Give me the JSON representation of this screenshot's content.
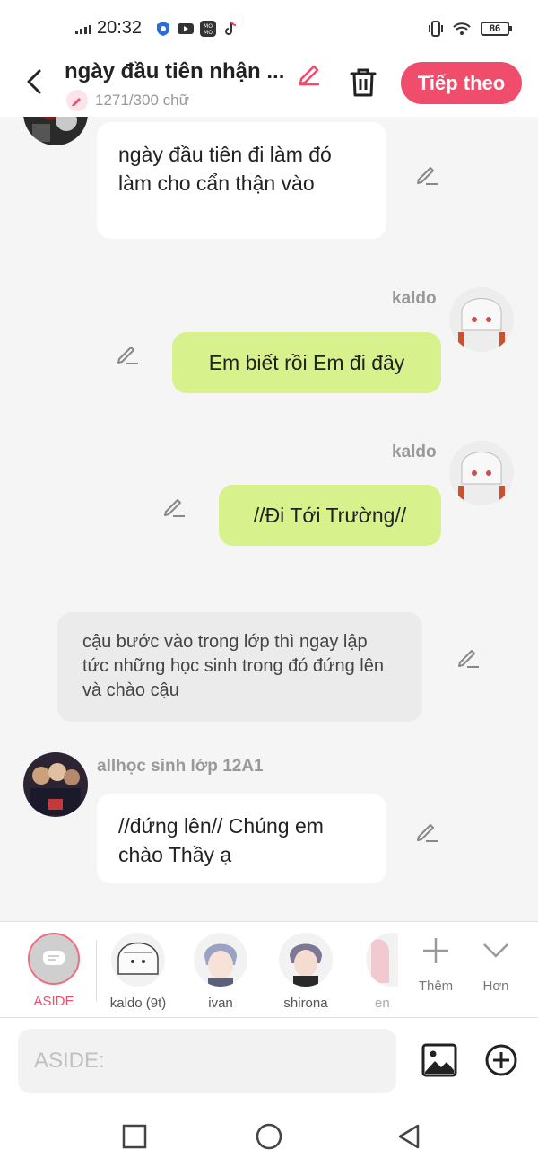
{
  "status_bar": {
    "time": "20:32",
    "battery": "86",
    "icons": [
      "signal-icon",
      "shield-app-icon",
      "youtube-icon",
      "momo-icon",
      "tiktok-icon",
      "vibrate-icon",
      "wifi-icon",
      "battery-icon"
    ]
  },
  "header": {
    "title": "ngày đầu tiên nhận ...",
    "char_count": "1271/300 chữ",
    "next_label": "Tiếp theo",
    "accent_color": "#f04d6c"
  },
  "messages": [
    {
      "type": "left",
      "sender": "",
      "text": "ngày đầu tiên đi làm đó làm cho cẩn thận vào"
    },
    {
      "type": "right",
      "sender": "kaldo",
      "text": "Em biết rồi Em đi đây"
    },
    {
      "type": "right",
      "sender": "kaldo",
      "text": "//Đi Tới Trường//"
    },
    {
      "type": "aside",
      "sender": "",
      "text": "cậu bước vào trong lớp thì ngay lập tức những học sinh trong đó đứng lên và chào cậu"
    },
    {
      "type": "left",
      "sender": "allhọc sinh lớp 12A1",
      "text": "//đứng lên// Chúng em chào Thầy ạ"
    }
  ],
  "characters": [
    {
      "label": "ASIDE"
    },
    {
      "label": "kaldo (9t)"
    },
    {
      "label": "ivan"
    },
    {
      "label": "shirona"
    },
    {
      "label": "en"
    }
  ],
  "tools": {
    "add_label": "Thêm",
    "more_label": "Hơn"
  },
  "input": {
    "placeholder": "ASIDE:"
  },
  "colors": {
    "green_bubble": "#d7f18c",
    "white_bubble": "#ffffff",
    "aside_bubble": "#ebebeb",
    "background": "#f5f5f5"
  }
}
